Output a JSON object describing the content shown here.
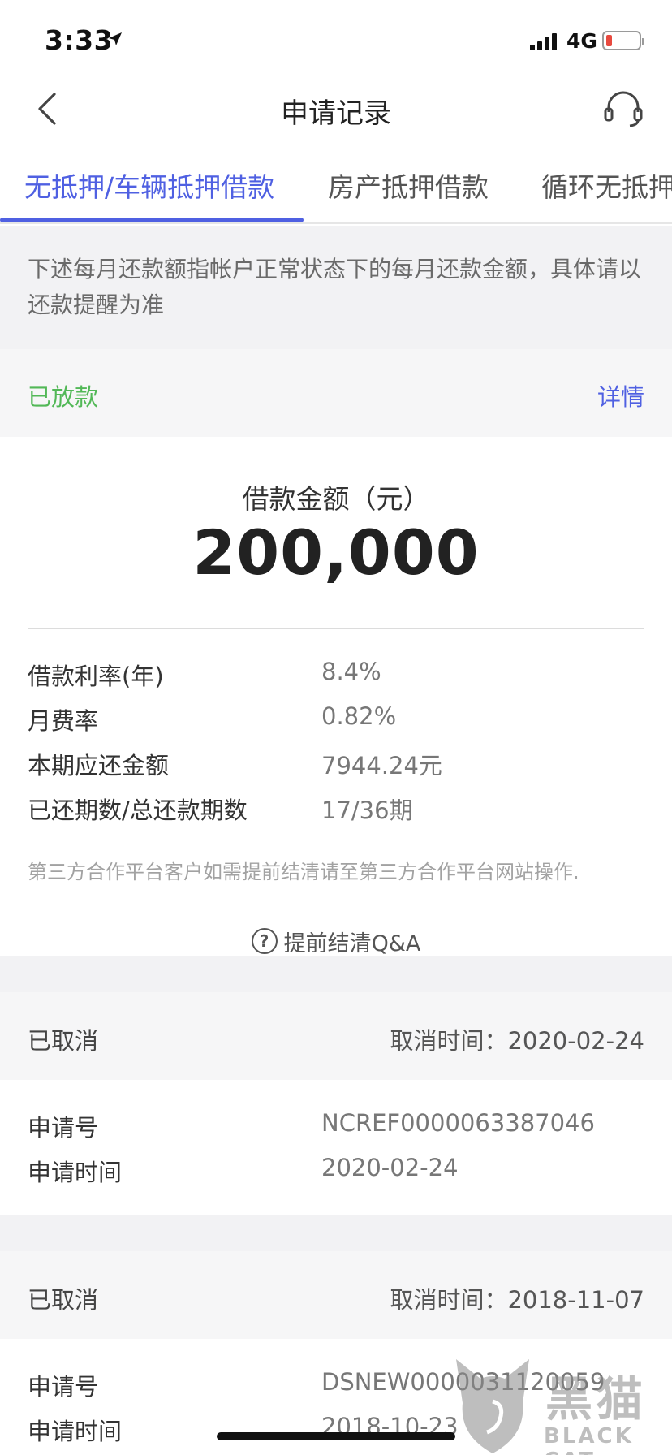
{
  "status_bar": {
    "time": "3:33",
    "network": "4G"
  },
  "nav": {
    "title": "申请记录"
  },
  "tabs": [
    {
      "label": "无抵押/车辆抵押借款",
      "active": true
    },
    {
      "label": "房产抵押借款",
      "active": false
    },
    {
      "label": "循环无抵押借款",
      "active": false
    }
  ],
  "notice": "下述每月还款额指帐户正常状态下的每月还款金额，具体请以还款提醒为准",
  "loan_card": {
    "status": "已放款",
    "detail_label": "详情",
    "amount_label": "借款金额（元）",
    "amount_value": "200,000",
    "rows": [
      {
        "label": "借款利率(年)",
        "value": "8.4%"
      },
      {
        "label": "月费率",
        "value": "0.82%"
      },
      {
        "label": "本期应还金额",
        "value": "7944.24元"
      },
      {
        "label": "已还期数/总还款期数",
        "value": "17/36期"
      }
    ],
    "footnote": "第三方合作平台客户如需提前结清请至第三方合作平台网站操作.",
    "qa_label": "提前结清Q&A"
  },
  "cancelled_records": [
    {
      "status": "已取消",
      "cancel_time": "取消时间：2020-02-24",
      "app_no_label": "申请号",
      "app_no": "NCREF0000063387046",
      "app_time_label": "申请时间",
      "app_time": "2020-02-24"
    },
    {
      "status": "已取消",
      "cancel_time": "取消时间：2018-11-07",
      "app_no_label": "申请号",
      "app_no": "DSNEW0000031120059",
      "app_time_label": "申请时间",
      "app_time": "2018-10-23"
    }
  ],
  "watermark": {
    "text": "黑猫",
    "sub": "BLACK CAT"
  },
  "colors": {
    "accent": "#4f60e2",
    "success": "#52b857",
    "panel": "#f2f2f4"
  }
}
